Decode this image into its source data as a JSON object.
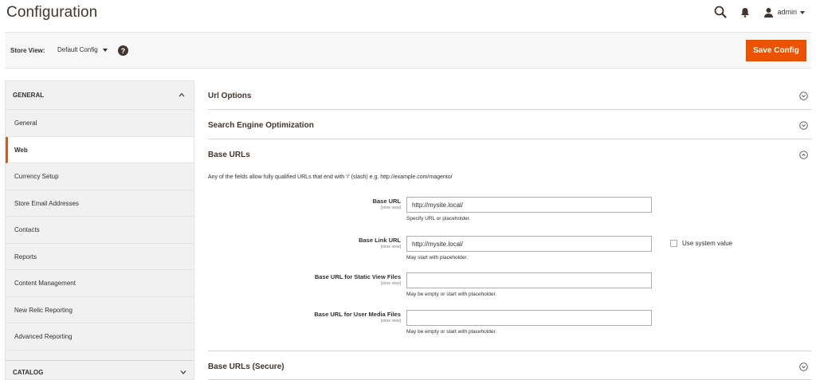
{
  "header": {
    "title": "Configuration",
    "search_icon": "search-icon",
    "notifications_icon": "bell-icon",
    "user_icon": "user-icon",
    "admin_label": "admin"
  },
  "store_bar": {
    "label": "Store View:",
    "selected_scope": "Default Config",
    "help_glyph": "?",
    "save_label": "Save Config"
  },
  "colors": {
    "accent": "#eb5202",
    "text": "#303030",
    "title": "#41362f",
    "sidebar_bg": "#f1f1f1"
  },
  "sidebar": {
    "general_section": {
      "title": "GENERAL",
      "expanded": true,
      "items": [
        {
          "label": "General",
          "active": false
        },
        {
          "label": "Web",
          "active": true
        },
        {
          "label": "Currency Setup",
          "active": false
        },
        {
          "label": "Store Email Addresses",
          "active": false
        },
        {
          "label": "Contacts",
          "active": false
        },
        {
          "label": "Reports",
          "active": false
        },
        {
          "label": "Content Management",
          "active": false
        },
        {
          "label": "New Relic Reporting",
          "active": false
        },
        {
          "label": "Advanced Reporting",
          "active": false
        }
      ]
    },
    "catalog_section": {
      "title": "CATALOG",
      "expanded": false
    }
  },
  "main": {
    "sections": [
      {
        "title": "Url Options",
        "expanded": false
      },
      {
        "title": "Search Engine Optimization",
        "expanded": false
      },
      {
        "title": "Base URLs",
        "expanded": true
      },
      {
        "title": "Base URLs (Secure)",
        "expanded": false
      }
    ],
    "base_urls": {
      "description": "Any of the fields allow fully qualified URLs that end with '/' (slash) e.g. http://example.com/magento/",
      "fields": [
        {
          "label": "Base URL",
          "scope": "[store view]",
          "value": "http://mysite.local/",
          "note": "Specify URL or placeholder."
        },
        {
          "label": "Base Link URL",
          "scope": "[store view]",
          "value": "http://mysite.local/",
          "note": "May start with placeholder.",
          "use_system_value": "Use system value",
          "use_system_checked": false
        },
        {
          "label": "Base URL for Static View Files",
          "scope": "[store view]",
          "value": "",
          "note": "May be empty or start with placeholder."
        },
        {
          "label": "Base URL for User Media Files",
          "scope": "[store view]",
          "value": "",
          "note": "May be empty or start with placeholder."
        }
      ]
    }
  }
}
